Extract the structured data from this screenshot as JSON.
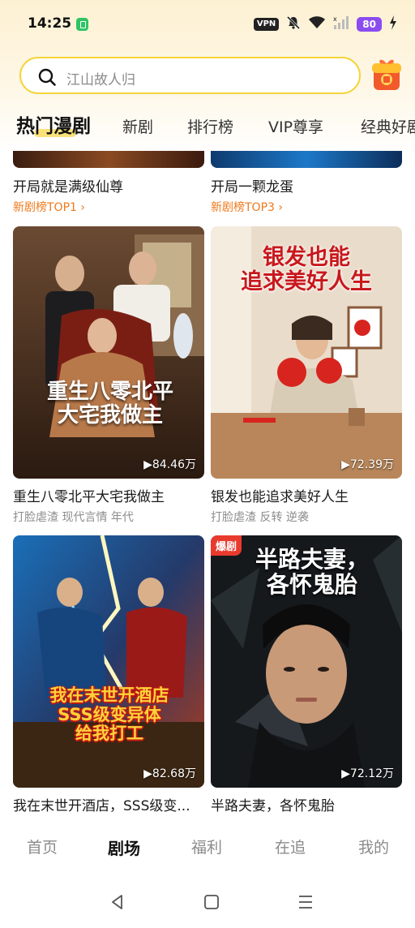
{
  "status": {
    "time": "14:25",
    "vpn": "VPN",
    "battery": "80",
    "mute_glyph": "🔕",
    "wifi_glyph": "",
    "signal_glyph": "",
    "charge_glyph": "⚡"
  },
  "search": {
    "placeholder": "江山故人归"
  },
  "categories": [
    {
      "label": "热门漫剧",
      "active": true
    },
    {
      "label": "新剧",
      "active": false
    },
    {
      "label": "排行榜",
      "active": false
    },
    {
      "label": "VIP尊享",
      "active": false
    },
    {
      "label": "经典好剧",
      "active": false
    }
  ],
  "top_row": [
    {
      "title": "开局就是满级仙尊",
      "rank": "新剧榜TOP1 ›"
    },
    {
      "title": "开局一颗龙蛋",
      "rank": "新剧榜TOP3 ›"
    }
  ],
  "cards": [
    {
      "headline": "重生八零北平\n大宅我做主",
      "views": "▶84.46万",
      "title": "重生八零北平大宅我做主",
      "tags": "打脸虐渣 现代言情 年代"
    },
    {
      "headline": "银发也能\n追求美好人生",
      "views": "▶72.39万",
      "title": "银发也能追求美好人生",
      "tags": "打脸虐渣 反转 逆袭"
    },
    {
      "headline": "我在末世开酒店\nSSS级变异体\n给我打工",
      "views": "▶82.68万",
      "title": "我在末世开酒店，SSS级变...",
      "tags": ""
    },
    {
      "headline": "半路夫妻，\n各怀鬼胎",
      "views": "▶72.12万",
      "title": "半路夫妻，各怀鬼胎",
      "tags": "",
      "badge": "爆剧"
    }
  ],
  "bottom_nav": [
    {
      "label": "首页",
      "active": false
    },
    {
      "label": "剧场",
      "active": true
    },
    {
      "label": "福利",
      "active": false
    },
    {
      "label": "在追",
      "active": false
    },
    {
      "label": "我的",
      "active": false
    }
  ],
  "colors": {
    "accent_yellow": "#f4d43a",
    "rank_orange": "#ef7a1c",
    "badge_red": "#e93a2e",
    "battery_purple": "#8a4cf0"
  },
  "icons": [
    "search-icon",
    "gift-icon",
    "back-icon",
    "home-icon",
    "menu-icon"
  ]
}
